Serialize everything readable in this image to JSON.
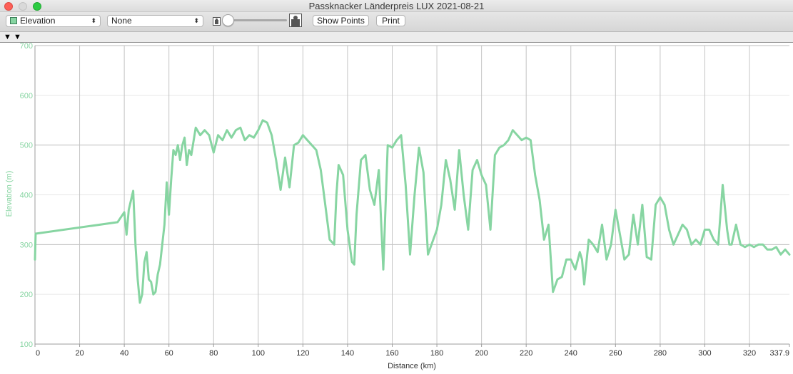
{
  "window": {
    "title": "Passknacker Länderpreis LUX 2021-08-21"
  },
  "toolbar": {
    "primary_select": "Elevation",
    "secondary_select": "None",
    "show_points_label": "Show Points",
    "print_label": "Print",
    "accent_color": "#87d5a2"
  },
  "chart_data": {
    "type": "line",
    "xlabel": "Distance (km)",
    "ylabel": "Elevation (m)",
    "xlim": [
      0,
      337.9
    ],
    "ylim": [
      100,
      700
    ],
    "x_ticks": [
      "0",
      "20",
      "40",
      "60",
      "80",
      "100",
      "120",
      "140",
      "160",
      "180",
      "200",
      "220",
      "240",
      "260",
      "280",
      "300",
      "320",
      "337.9"
    ],
    "y_ticks": [
      "100",
      "200",
      "300",
      "400",
      "500",
      "600",
      "700"
    ],
    "grid": true,
    "color": "#87d5a2",
    "series": [
      {
        "x": [
          0,
          0.3,
          37,
          40,
          41,
          42,
          44,
          45,
          46,
          47,
          48,
          49,
          50,
          51,
          52,
          53,
          54,
          55,
          56,
          57,
          58,
          59,
          60,
          61,
          62,
          63,
          64,
          65,
          66,
          67,
          68,
          69,
          70,
          72,
          74,
          76,
          78,
          80,
          82,
          84,
          86,
          88,
          90,
          92,
          94,
          96,
          98,
          100,
          102,
          104,
          106,
          108,
          110,
          112,
          114,
          116,
          118,
          120,
          122,
          124,
          126,
          128,
          130,
          132,
          134,
          135,
          136,
          138,
          140,
          142,
          143,
          144,
          146,
          148,
          150,
          152,
          154,
          156,
          158,
          160,
          162,
          164,
          166,
          168,
          170,
          172,
          174,
          176,
          178,
          180,
          182,
          184,
          186,
          188,
          190,
          192,
          194,
          196,
          198,
          200,
          202,
          204,
          206,
          208,
          210,
          212,
          214,
          216,
          218,
          220,
          222,
          224,
          226,
          228,
          230,
          232,
          234,
          236,
          238,
          240,
          242,
          244,
          245,
          246,
          248,
          250,
          252,
          254,
          256,
          258,
          260,
          262,
          264,
          266,
          268,
          270,
          272,
          274,
          276,
          278,
          280,
          282,
          284,
          286,
          288,
          290,
          292,
          294,
          296,
          298,
          300,
          302,
          304,
          306,
          308,
          310,
          311,
          312,
          314,
          316,
          318,
          320,
          322,
          324,
          326,
          328,
          330,
          332,
          334,
          336,
          337.9
        ],
        "y": [
          270,
          322,
          345,
          365,
          320,
          370,
          408,
          300,
          230,
          183,
          200,
          265,
          285,
          230,
          225,
          200,
          205,
          240,
          260,
          300,
          340,
          425,
          360,
          430,
          490,
          480,
          500,
          470,
          500,
          515,
          460,
          490,
          480,
          535,
          520,
          530,
          520,
          485,
          520,
          510,
          530,
          515,
          530,
          535,
          510,
          520,
          515,
          530,
          550,
          545,
          520,
          470,
          410,
          475,
          415,
          500,
          505,
          520,
          510,
          500,
          490,
          450,
          380,
          310,
          300,
          400,
          460,
          440,
          330,
          265,
          260,
          360,
          470,
          480,
          410,
          380,
          450,
          250,
          500,
          495,
          510,
          520,
          420,
          280,
          400,
          495,
          445,
          280,
          305,
          330,
          380,
          470,
          430,
          370,
          490,
          400,
          330,
          450,
          470,
          440,
          420,
          330,
          480,
          495,
          500,
          510,
          530,
          520,
          510,
          515,
          510,
          440,
          390,
          310,
          340,
          205,
          230,
          235,
          270,
          270,
          250,
          285,
          270,
          220,
          310,
          300,
          285,
          340,
          270,
          300,
          370,
          320,
          270,
          280,
          360,
          300,
          380,
          275,
          270,
          380,
          395,
          380,
          330,
          300,
          320,
          340,
          330,
          300,
          310,
          300,
          330,
          330,
          310,
          300,
          420,
          330,
          300,
          300,
          340,
          300,
          295,
          300,
          295,
          300,
          300,
          290,
          290,
          295,
          280,
          290,
          280
        ],
        "y_note": ""
      }
    ]
  }
}
